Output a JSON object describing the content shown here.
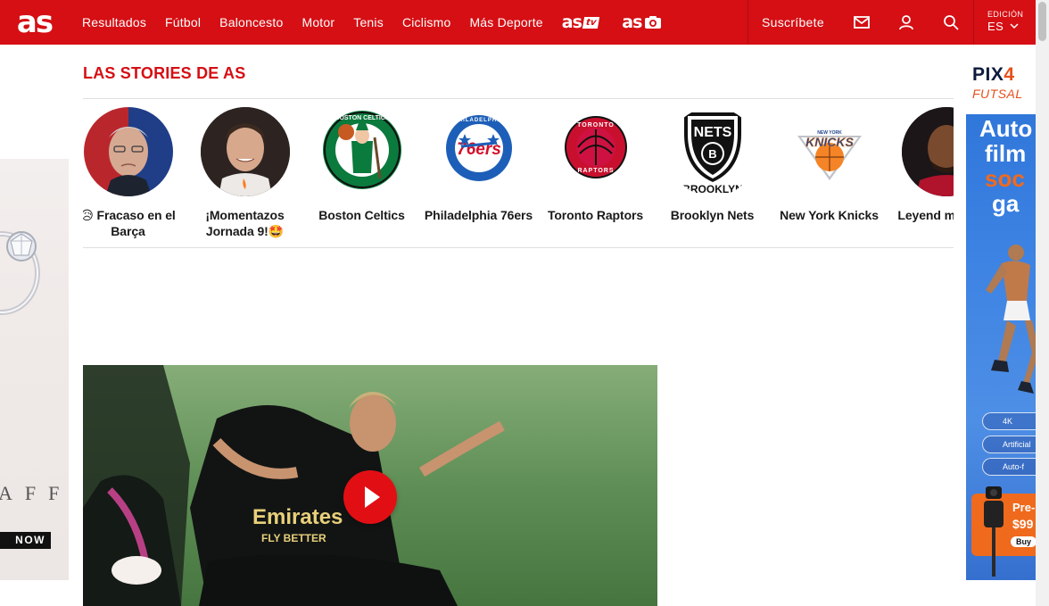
{
  "header": {
    "logo": "as",
    "nav": [
      "Resultados",
      "Fútbol",
      "Baloncesto",
      "Motor",
      "Tenis",
      "Ciclismo",
      "Más Deporte"
    ],
    "brand_tv": "as",
    "brand_tv_tag": "tv",
    "brand_photo": "as",
    "subscribe": "Suscríbete",
    "edition_label": "EDICIÓN",
    "edition_value": "ES"
  },
  "left_ad": {
    "wordmark": "AFF",
    "cta": "NOW"
  },
  "right_ad": {
    "brand_a": "PIX",
    "brand_b": "4",
    "sub": "FUTSAL",
    "headline_1": "Auto",
    "headline_2": "film",
    "headline_3": "soc",
    "headline_4": "ga",
    "features": [
      "4K",
      "Artificial",
      "Auto-f"
    ],
    "promo_1": "Pre-",
    "promo_2": "$99",
    "promo_cta": "Buy"
  },
  "stories": {
    "title": "LAS STORIES DE AS",
    "items": [
      {
        "label": "😥 Fracaso en el Barça",
        "icon": "person-portrait"
      },
      {
        "label": "¡Momentazos Jornada 9!🤩",
        "icon": "player-portrait"
      },
      {
        "label": "Boston Celtics",
        "icon": "celtics-logo"
      },
      {
        "label": "Philadelphia 76ers",
        "icon": "76ers-logo"
      },
      {
        "label": "Toronto Raptors",
        "icon": "raptors-logo"
      },
      {
        "label": "Brooklyn Nets",
        "icon": "nets-logo"
      },
      {
        "label": "New York Knicks",
        "icon": "knicks-logo"
      },
      {
        "label": "Leyend mate a L",
        "icon": "player-portrait"
      }
    ]
  },
  "logos": {
    "celtics": "BOSTON CELTICS",
    "sixers_ring": "PHILADELPHIA",
    "sixers": "76ers",
    "raptors_top": "TORONTO",
    "raptors_bottom": "RAPTORS",
    "nets": "NETS",
    "nets_city": "BROOKLYN",
    "knicks_city": "NEW YORK",
    "knicks": "KNICKS"
  },
  "video": {
    "sponsor": "Emirates",
    "sponsor_sub": "FLY BETTER"
  },
  "colors": {
    "brand_red": "#d50f14",
    "play_red": "#e10f14"
  }
}
